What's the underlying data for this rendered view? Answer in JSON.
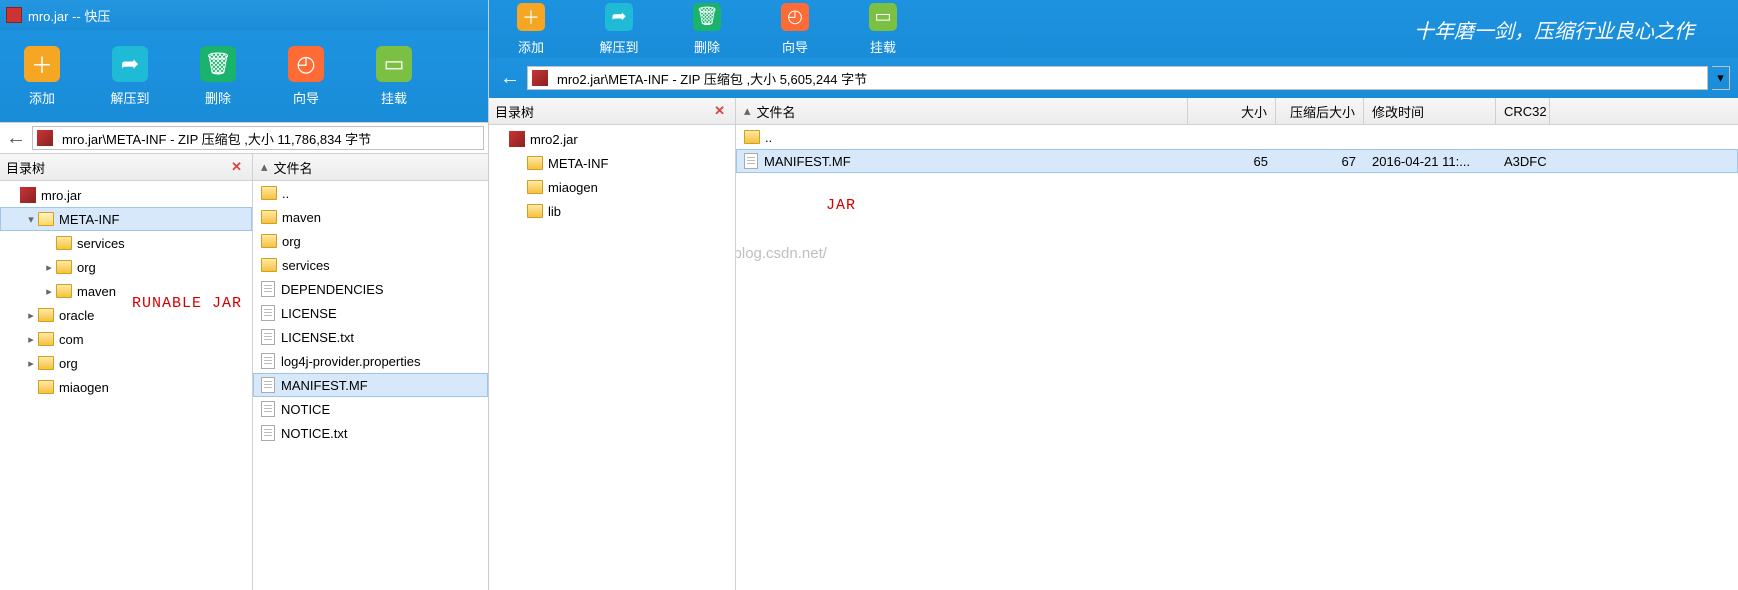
{
  "left": {
    "title": "mro.jar -- 快压",
    "toolbar": {
      "add": "添加",
      "extract": "解压到",
      "delete": "删除",
      "wizard": "向导",
      "mount": "挂载"
    },
    "address": "mro.jar\\META-INF - ZIP 压缩包 ,大小 11,786,834 字节",
    "tree_head": "目录树",
    "list_head": {
      "name": "文件名"
    },
    "tree": [
      {
        "name": "mro.jar",
        "depth": 0,
        "exp": "",
        "icon": "jar"
      },
      {
        "name": "META-INF",
        "depth": 1,
        "exp": "▾",
        "icon": "folder-open",
        "sel": true
      },
      {
        "name": "services",
        "depth": 2,
        "exp": "",
        "icon": "folder"
      },
      {
        "name": "org",
        "depth": 2,
        "exp": "▸",
        "icon": "folder"
      },
      {
        "name": "maven",
        "depth": 2,
        "exp": "▸",
        "icon": "folder"
      },
      {
        "name": "oracle",
        "depth": 1,
        "exp": "▸",
        "icon": "folder"
      },
      {
        "name": "com",
        "depth": 1,
        "exp": "▸",
        "icon": "folder"
      },
      {
        "name": "org",
        "depth": 1,
        "exp": "▸",
        "icon": "folder"
      },
      {
        "name": "miaogen",
        "depth": 1,
        "exp": "",
        "icon": "folder"
      }
    ],
    "files": [
      {
        "name": "..",
        "icon": "folder"
      },
      {
        "name": "maven",
        "icon": "folder"
      },
      {
        "name": "org",
        "icon": "folder"
      },
      {
        "name": "services",
        "icon": "folder"
      },
      {
        "name": "DEPENDENCIES",
        "icon": "file"
      },
      {
        "name": "LICENSE",
        "icon": "file"
      },
      {
        "name": "LICENSE.txt",
        "icon": "file"
      },
      {
        "name": "log4j-provider.properties",
        "icon": "file"
      },
      {
        "name": "MANIFEST.MF",
        "icon": "file",
        "sel": true
      },
      {
        "name": "NOTICE",
        "icon": "file"
      },
      {
        "name": "NOTICE.txt",
        "icon": "file"
      }
    ],
    "annotation": "RUNABLE JAR"
  },
  "right": {
    "toolbar": {
      "add": "添加",
      "extract": "解压到",
      "delete": "删除",
      "wizard": "向导",
      "mount": "挂载"
    },
    "slogan": "十年磨一剑，压缩行业良心之作",
    "address": "mro2.jar\\META-INF - ZIP 压缩包 ,大小 5,605,244 字节",
    "tree_head": "目录树",
    "list_head": {
      "name": "文件名",
      "size": "大小",
      "packed": "压缩后大小",
      "modified": "修改时间",
      "crc": "CRC32"
    },
    "tree": [
      {
        "name": "mro2.jar",
        "depth": 0,
        "exp": "",
        "icon": "jar"
      },
      {
        "name": "META-INF",
        "depth": 1,
        "exp": "",
        "icon": "folder"
      },
      {
        "name": "miaogen",
        "depth": 1,
        "exp": "",
        "icon": "folder"
      },
      {
        "name": "lib",
        "depth": 1,
        "exp": "",
        "icon": "folder"
      }
    ],
    "files": [
      {
        "name": "..",
        "icon": "folder",
        "size": "",
        "packed": "",
        "mod": "",
        "crc": ""
      },
      {
        "name": "MANIFEST.MF",
        "icon": "file",
        "size": "65",
        "packed": "67",
        "mod": "2016-04-21   11:...",
        "crc": "A3DFC",
        "sel": true
      }
    ],
    "annotation": "JAR",
    "watermark": "http://blog.csdn.net/"
  }
}
